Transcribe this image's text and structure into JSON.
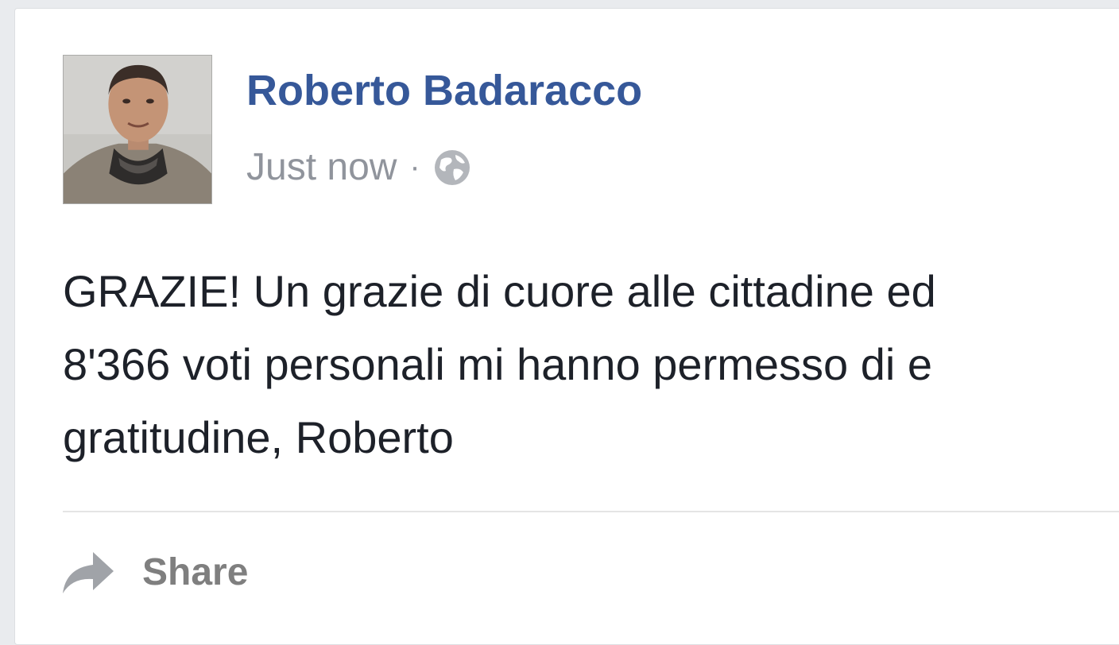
{
  "post": {
    "author": "Roberto Badaracco",
    "timestamp": "Just now",
    "separator": "·",
    "privacy_icon": "globe-icon",
    "lines": [
      "GRAZIE! Un grazie di cuore alle cittadine ed",
      "8'366 voti personali mi hanno permesso di e",
      "gratitudine, Roberto"
    ]
  },
  "actions": {
    "share_label": "Share",
    "share_icon": "share-arrow-icon"
  },
  "colors": {
    "author_link": "#365899",
    "meta_text": "#90949c",
    "body_text": "#1d2129",
    "action_text": "#7f7f7f",
    "page_background": "#e9ebee"
  }
}
